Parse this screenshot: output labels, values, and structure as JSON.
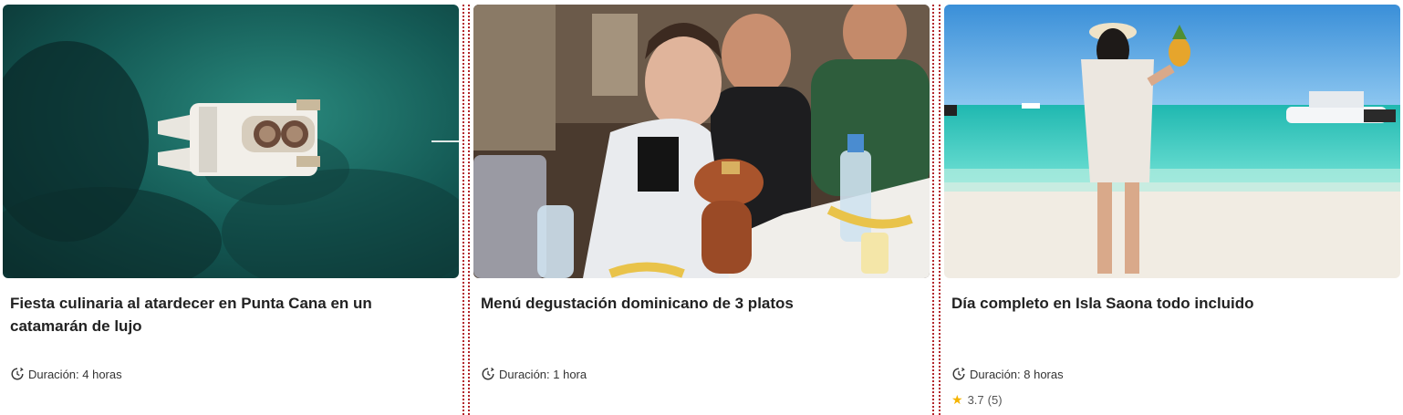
{
  "cards": [
    {
      "title": "Fiesta culinaria al atardecer en Punta Cana en un catamarán de lujo",
      "duration": "Duración: 4 horas",
      "image_alt": "aerial view of catamaran on turquoise sea"
    },
    {
      "title": "Menú degustación dominicano de 3 platos",
      "duration": "Duración: 1 hora",
      "image_alt": "woman smelling food in clay pot at restaurant table"
    },
    {
      "title": "Día completo en Isla Saona todo incluido",
      "duration": "Duración: 8 horas",
      "rating": "3.7",
      "rating_count": "(5)",
      "image_alt": "woman holding pineapple on tropical beach"
    }
  ],
  "colors": {
    "divider": "#b3262b",
    "star": "#f5b400"
  },
  "icons": [
    "clock-icon",
    "star-icon"
  ]
}
